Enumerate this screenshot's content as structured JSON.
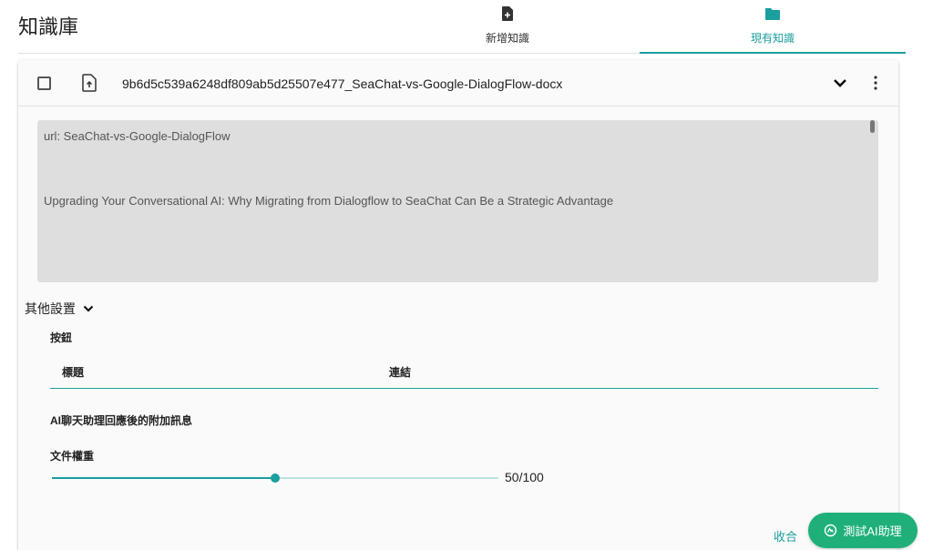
{
  "header": {
    "title": "知識庫",
    "tabs": [
      {
        "label": "新增知識",
        "icon": "file-add-icon"
      },
      {
        "label": "現有知識",
        "icon": "folder-icon",
        "active": true
      }
    ]
  },
  "document": {
    "file_name": "9b6d5c539a6248df809ab5d25507e477_SeaChat-vs-Google-DialogFlow-docx",
    "content_lines": [
      "url: SeaChat-vs-Google-DialogFlow",
      "Upgrading Your Conversational AI: Why Migrating from Dialogflow to SeaChat Can Be a Strategic Advantage"
    ]
  },
  "settings": {
    "toggle_label": "其他設置",
    "buttons_label": "按鈕",
    "table_headers": [
      "標題",
      "連結"
    ],
    "extra_message_label": "AI聊天助理回應後的附加訊息",
    "weight_label": "文件權重",
    "weight_value": 50,
    "weight_max": 100,
    "weight_text": "50/100"
  },
  "footer": {
    "collapse_label": "收合",
    "test_ai_label": "測試AI助理"
  },
  "colors": {
    "accent": "#1a9e9e",
    "button_green": "#1fb07a"
  }
}
